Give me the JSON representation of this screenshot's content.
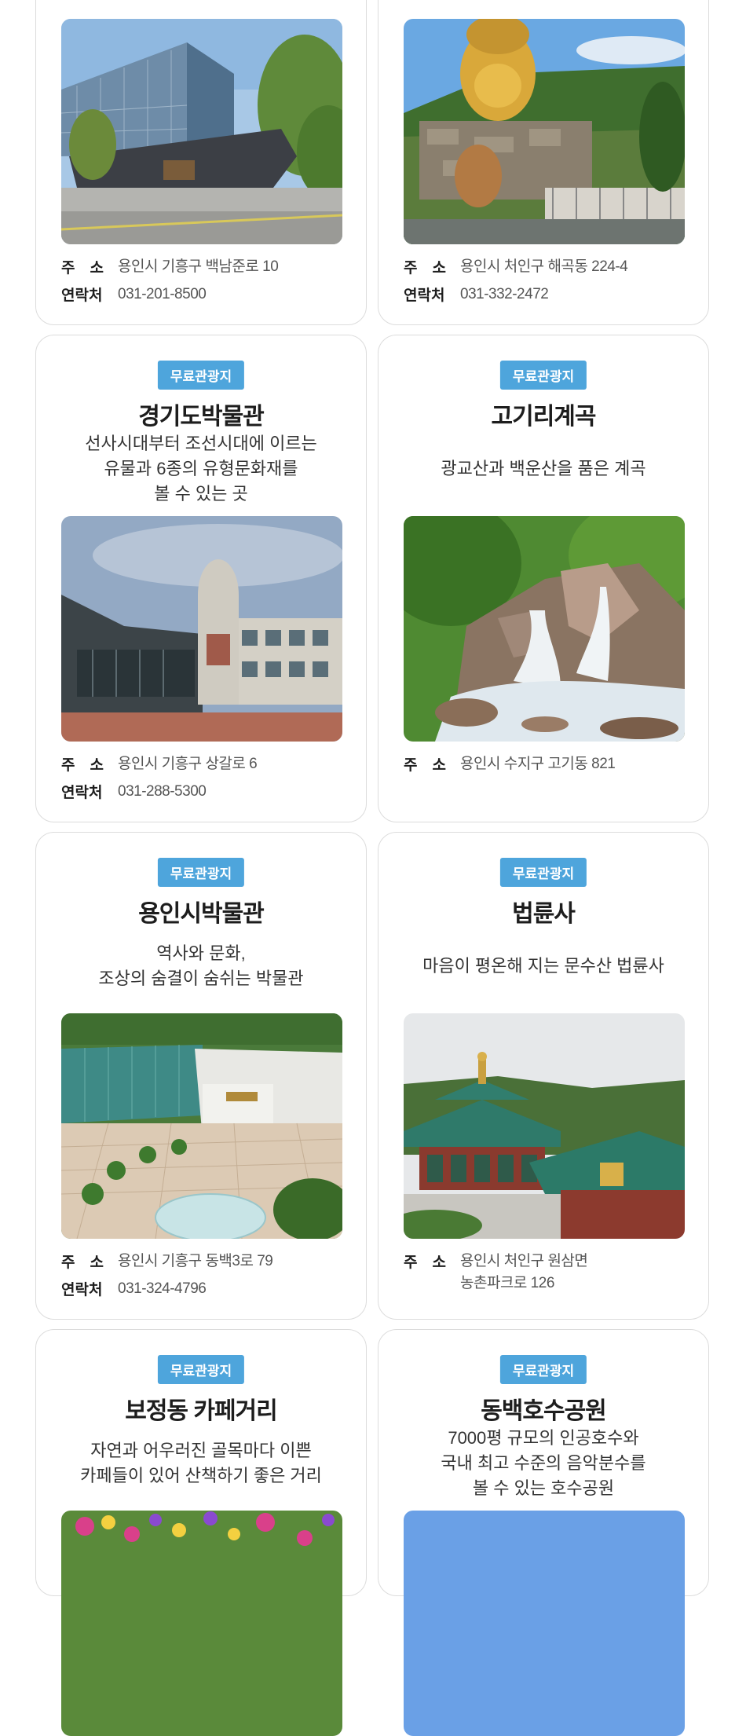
{
  "badge_text": "무료관광지",
  "labels": {
    "address": "주　소",
    "contact": "연락처"
  },
  "cards": [
    {
      "address": "용인시 기흥구 백남준로 10",
      "contact": "031-201-8500"
    },
    {
      "address": "용인시 처인구 해곡동 224-4",
      "contact": "031-332-2472"
    },
    {
      "title": "경기도박물관",
      "desc": [
        "선사시대부터 조선시대에 이르는",
        "유물과 6종의 유형문화재를",
        "볼 수 있는 곳"
      ],
      "address": "용인시 기흥구 상갈로 6",
      "contact": "031-288-5300"
    },
    {
      "title": "고기리계곡",
      "desc": [
        "광교산과 백운산을 품은 계곡"
      ],
      "address": "용인시 수지구 고기동 821"
    },
    {
      "title": "용인시박물관",
      "desc": [
        "역사와 문화,",
        "조상의 숨결이 숨쉬는 박물관"
      ],
      "address": "용인시 기흥구 동백3로 79",
      "contact": "031-324-4796"
    },
    {
      "title": "법륜사",
      "desc": [
        "마음이 평온해 지는 문수산 법륜사"
      ],
      "address": "용인시 처인구 원삼면",
      "address2": "농촌파크로 126"
    },
    {
      "title": "보정동 카페거리",
      "desc": [
        "자연과 어우러진 골목마다 이쁜",
        "카페들이 있어 산책하기 좋은 거리"
      ]
    },
    {
      "title": "동백호수공원",
      "desc": [
        "7000평 규모의 인공호수와",
        "국내 최고 수준의 음악분수를",
        "볼 수 있는 호수공원"
      ]
    }
  ]
}
